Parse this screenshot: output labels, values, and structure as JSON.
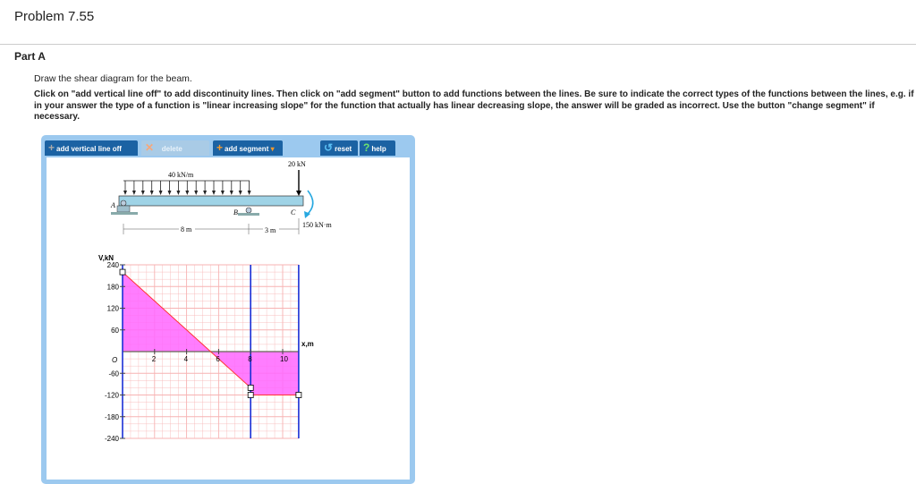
{
  "title": "Problem 7.55",
  "part": "Part A",
  "intro": "Draw the shear diagram for the beam.",
  "instructions": "Click on \"add vertical line off\" to add discontinuity lines. Then click on \"add segment\" button to add functions between the lines. Be sure to indicate the correct types of the functions between the lines, e.g. if in your answer the type of a function is \"linear increasing slope\" for the function that actually has linear decreasing slope, the answer will be graded as incorrect. Use the button \"change segment\" if necessary.",
  "toolbar": {
    "add_vertical": "add vertical line off",
    "delete": "delete",
    "add_segment": "add segment",
    "reset": "reset",
    "help": "help"
  },
  "figure": {
    "dist_load": "40 kN/m",
    "point_load": "20 kN",
    "moment": "150 kN·m",
    "A": "A",
    "B": "B",
    "C": "C",
    "dim1": "8 m",
    "dim2": "3 m"
  },
  "chart_data": {
    "type": "line",
    "ylabel": "V,kN",
    "xlabel": "x,m",
    "origin_label": "O",
    "xlim": [
      0,
      11
    ],
    "ylim": [
      -240,
      240
    ],
    "xticks": [
      2,
      4,
      6,
      8,
      10
    ],
    "yticks": [
      240,
      180,
      120,
      60,
      -60,
      -120,
      -180,
      -240
    ],
    "vertical_lines": [
      0,
      8,
      11
    ],
    "segments": [
      {
        "type": "linear decreasing",
        "points": [
          [
            0,
            220
          ],
          [
            8,
            -100
          ]
        ]
      },
      {
        "type": "constant",
        "points": [
          [
            8,
            -120
          ],
          [
            11,
            -120
          ]
        ]
      }
    ],
    "colors": {
      "fill": "#ff66ff",
      "line": "#ff3333",
      "vline": "#1a2fd6",
      "grid": "#f7b3b3"
    }
  }
}
